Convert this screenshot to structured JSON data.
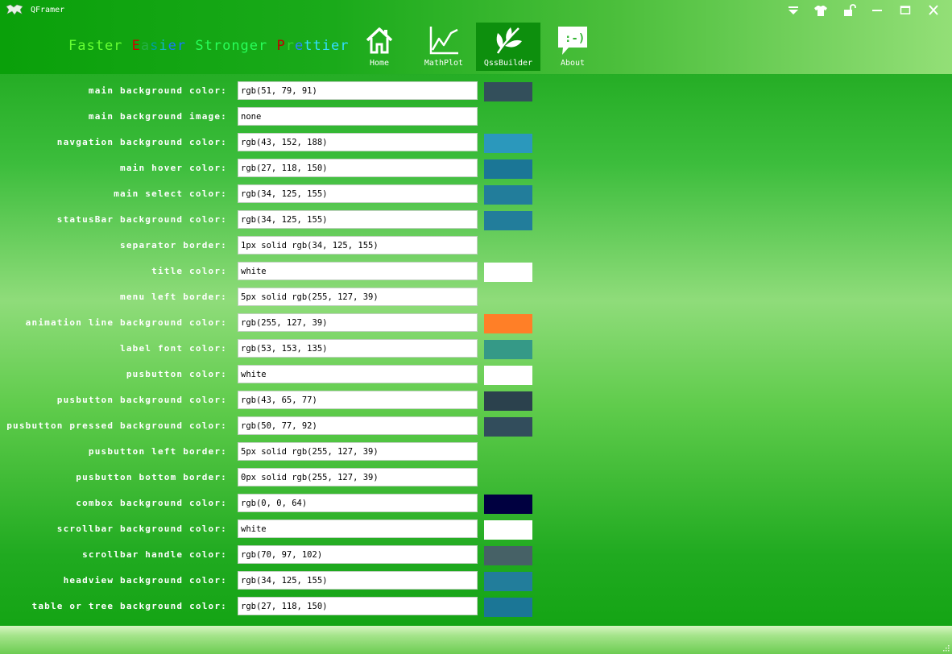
{
  "window": {
    "title": "QFramer",
    "slogan": [
      {
        "text": "Faster ",
        "color": "#66ff33"
      },
      {
        "text": "E",
        "color": "#d20000"
      },
      {
        "text": "a",
        "color": "#25b045"
      },
      {
        "text": "s",
        "color": "#009fa0"
      },
      {
        "text": "i",
        "color": "#14b4c8"
      },
      {
        "text": "er ",
        "color": "#1a78ff"
      },
      {
        "text": "Stronger ",
        "color": "#28ff5a"
      },
      {
        "text": "P",
        "color": "#c00000"
      },
      {
        "text": "r",
        "color": "#35d230"
      },
      {
        "text": "e",
        "color": "#2a82ff"
      },
      {
        "text": "ttier",
        "color": "#33ddff"
      }
    ],
    "controls": [
      "menu-dropdown-icon",
      "skin-shirt-icon",
      "unlock-icon",
      "minimize-icon",
      "maximize-icon",
      "close-icon"
    ]
  },
  "nav": {
    "tabs": [
      {
        "label": "Home",
        "icon": "home-icon",
        "active": false
      },
      {
        "label": "MathPlot",
        "icon": "chart-line-icon",
        "active": false
      },
      {
        "label": "QssBuilder",
        "icon": "leaf-icon",
        "active": true
      },
      {
        "label": "About",
        "icon": "smiley-chat-icon",
        "active": false
      }
    ]
  },
  "form": {
    "rows": [
      {
        "label": "main background color:",
        "value": "rgb(51, 79, 91)",
        "swatch": "#334f5b"
      },
      {
        "label": "main background image:",
        "value": "none",
        "swatch": null
      },
      {
        "label": "navgation background color:",
        "value": "rgb(43, 152, 188)",
        "swatch": "#2b98bc"
      },
      {
        "label": "main hover color:",
        "value": "rgb(27, 118, 150)",
        "swatch": "#1b7696"
      },
      {
        "label": "main select color:",
        "value": "rgb(34, 125, 155)",
        "swatch": "#227d9b"
      },
      {
        "label": "statusBar background color:",
        "value": "rgb(34, 125, 155)",
        "swatch": "#227d9b"
      },
      {
        "label": "separator border:",
        "value": "1px solid rgb(34, 125, 155)",
        "swatch": null
      },
      {
        "label": "title color:",
        "value": "white",
        "swatch": "#ffffff"
      },
      {
        "label": "menu left border:",
        "value": "5px solid rgb(255, 127, 39)",
        "swatch": null
      },
      {
        "label": "animation line background color:",
        "value": "rgb(255, 127, 39)",
        "swatch": "#ff7f27"
      },
      {
        "label": "label font color:",
        "value": "rgb(53, 153, 135)",
        "swatch": "#359987"
      },
      {
        "label": "pusbutton color:",
        "value": "white",
        "swatch": "#ffffff"
      },
      {
        "label": "pusbutton background color:",
        "value": "rgb(43, 65, 77)",
        "swatch": "#2b414d"
      },
      {
        "label": "pusbutton pressed background color:",
        "value": "rgb(50, 77, 92)",
        "swatch": "#324d5c"
      },
      {
        "label": "pusbutton left border:",
        "value": "5px solid rgb(255, 127, 39)",
        "swatch": null
      },
      {
        "label": "pusbutton bottom border:",
        "value": "0px solid rgb(255, 127, 39)",
        "swatch": null
      },
      {
        "label": "combox background color:",
        "value": "rgb(0, 0, 64)",
        "swatch": "#000040"
      },
      {
        "label": "scrollbar background color:",
        "value": "white",
        "swatch": "#ffffff"
      },
      {
        "label": "scrollbar handle color:",
        "value": "rgb(70, 97, 102)",
        "swatch": "#466166"
      },
      {
        "label": "headview background color:",
        "value": "rgb(34, 125, 155)",
        "swatch": "#227d9b"
      },
      {
        "label": "table or tree background color:",
        "value": "rgb(27, 118, 150)",
        "swatch": "#1b7696"
      }
    ]
  }
}
